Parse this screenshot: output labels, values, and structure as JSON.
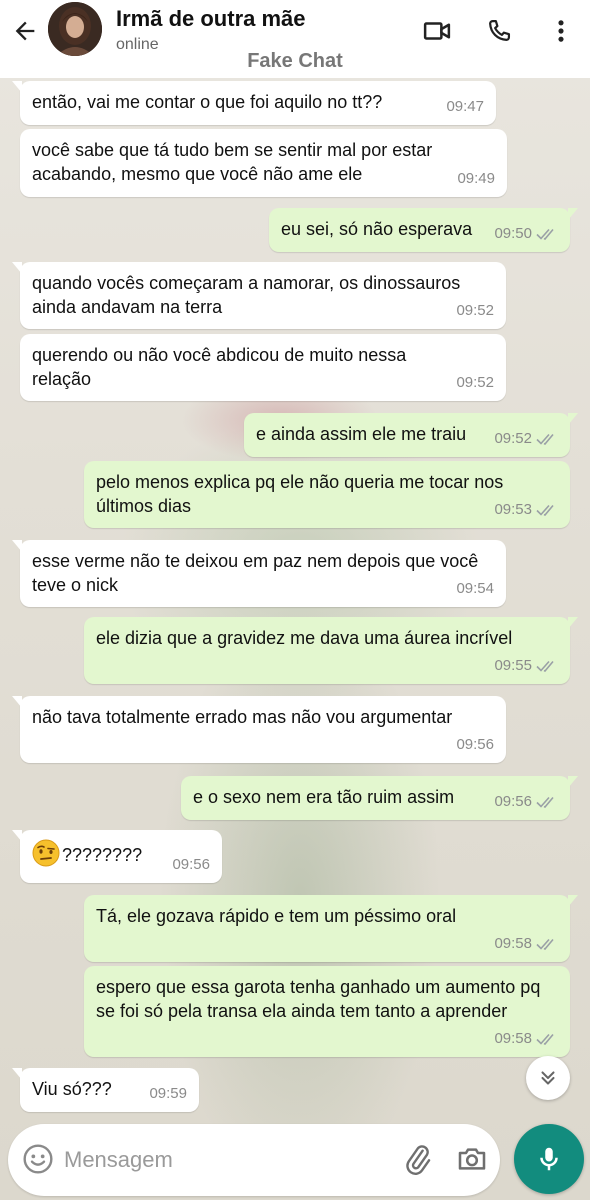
{
  "header": {
    "contact_name": "Irmã de outra mãe",
    "status": "online",
    "watermark": "Fake Chat"
  },
  "messages": [
    {
      "dir": "in",
      "text": "então, vai me contar o que foi aquilo no tt??",
      "time": "09:47"
    },
    {
      "dir": "in",
      "text": "você sabe que tá tudo bem se sentir mal por estar acabando, mesmo que você não ame ele",
      "time": "09:49"
    },
    {
      "dir": "out",
      "text": "eu sei, só não esperava",
      "time": "09:50",
      "read_ticks": true
    },
    {
      "dir": "in",
      "text": "quando vocês começaram a namorar, os dinossauros ainda andavam na terra",
      "time": "09:52"
    },
    {
      "dir": "in",
      "text": "querendo ou não você abdicou de muito nessa relação",
      "time": "09:52"
    },
    {
      "dir": "out",
      "text": "e ainda assim ele me traiu",
      "time": "09:52",
      "read_ticks": true
    },
    {
      "dir": "out",
      "text": "pelo menos explica pq ele não queria me tocar nos últimos dias",
      "time": "09:53",
      "read_ticks": true
    },
    {
      "dir": "in",
      "text": "esse verme não te deixou em paz nem depois que você teve o nick",
      "time": "09:54"
    },
    {
      "dir": "out",
      "text": "ele dizia que a gravidez me dava uma áurea incrível",
      "time": "09:55",
      "read_ticks": true
    },
    {
      "dir": "in",
      "text": "não tava totalmente errado mas não vou argumentar",
      "time": "09:56"
    },
    {
      "dir": "out",
      "text": "e o sexo nem era tão ruim assim",
      "time": "09:56",
      "read_ticks": true
    },
    {
      "dir": "in",
      "text": "????????",
      "emoji": "raised-eyebrow-face",
      "time": "09:56"
    },
    {
      "dir": "out",
      "text": "Tá, ele gozava rápido e tem um péssimo oral",
      "time": "09:58",
      "read_ticks": true
    },
    {
      "dir": "out",
      "text": "espero que essa garota tenha ganhado um aumento pq se foi só pela transa ela ainda tem tanto a aprender",
      "time": "09:58",
      "read_ticks": true
    },
    {
      "dir": "in",
      "text": "Viu só???",
      "time": "09:59"
    }
  ],
  "input": {
    "placeholder": "Mensagem"
  },
  "colors": {
    "outgoing_bubble": "#e3f7cf",
    "incoming_bubble": "#ffffff",
    "mic_button": "#128c7e",
    "read_ticks": "#9aa0a6"
  }
}
